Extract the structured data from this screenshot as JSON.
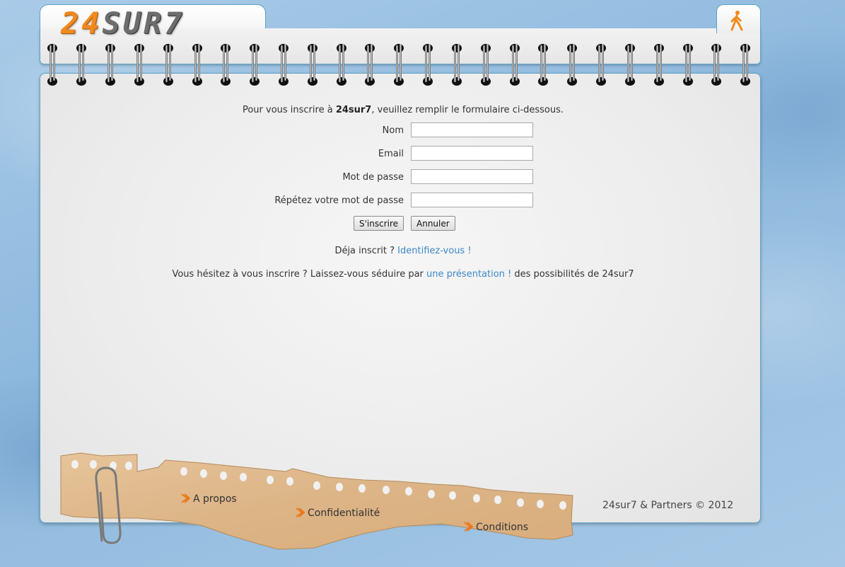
{
  "header": {
    "logo_digits": "24",
    "logo_text": "SUR7",
    "logout_icon": "walking-person-icon"
  },
  "form": {
    "intro_prefix": "Pour vous inscrire à ",
    "intro_brand": "24sur7",
    "intro_suffix": ", veuillez remplir le formulaire ci-dessous.",
    "fields": [
      {
        "label": "Nom",
        "value": ""
      },
      {
        "label": "Email",
        "value": ""
      },
      {
        "label": "Mot de passe",
        "value": ""
      },
      {
        "label": "Répétez votre mot de passe",
        "value": ""
      }
    ],
    "submit_label": "S'inscrire",
    "cancel_label": "Annuler"
  },
  "login_line": {
    "prefix": "Déja inscrit ? ",
    "link": "Identifiez-vous !"
  },
  "promo_line": {
    "prefix": "Vous hésitez à vous inscrire ? Laissez-vous séduire par ",
    "link": "une présentation !",
    "suffix": " des possibilités de 24sur7"
  },
  "footer": {
    "links": [
      "A propos",
      "Confidentialité",
      "Conditions"
    ],
    "copyright": "24sur7 & Partners © 2012"
  },
  "colors": {
    "accent_orange": "#f08a20",
    "link_blue": "#3c88c8",
    "frame_blue": "#5aa3c8"
  }
}
